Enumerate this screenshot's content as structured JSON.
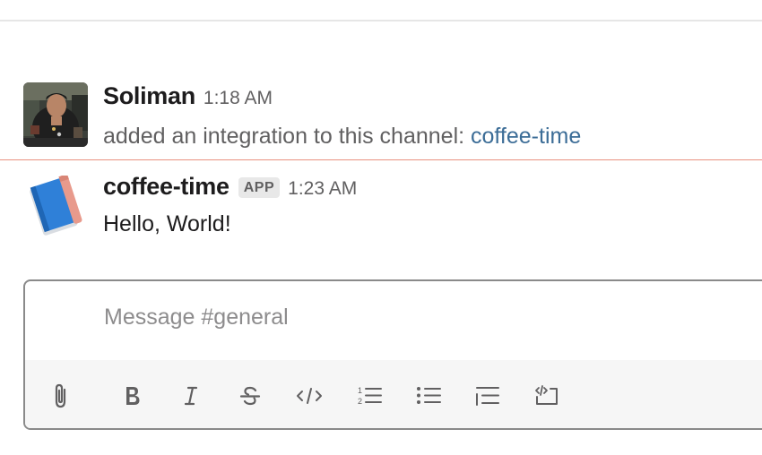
{
  "messages": [
    {
      "author": "Soliman",
      "time": "1:18 AM",
      "text_prefix": "added an integration to this channel: ",
      "integration_link": "coffee-time",
      "avatar_icon": "user-photo"
    },
    {
      "author": "coffee-time",
      "badge": "APP",
      "time": "1:23 AM",
      "text": "Hello, World!",
      "avatar_icon": "notebook-app-icon"
    }
  ],
  "composer": {
    "placeholder": "Message #general",
    "value": "",
    "toolbar": [
      {
        "name": "attach",
        "icon": "paperclip-icon"
      },
      {
        "name": "bold",
        "icon": "bold-icon"
      },
      {
        "name": "italic",
        "icon": "italic-icon"
      },
      {
        "name": "strikethrough",
        "icon": "strikethrough-icon"
      },
      {
        "name": "code",
        "icon": "code-icon"
      },
      {
        "name": "ordered-list",
        "icon": "ordered-list-icon"
      },
      {
        "name": "bulleted-list",
        "icon": "bulleted-list-icon"
      },
      {
        "name": "blockquote",
        "icon": "blockquote-icon"
      },
      {
        "name": "code-block",
        "icon": "code-block-icon"
      }
    ]
  },
  "colors": {
    "link": "#3c6d97",
    "new_message_divider": "#e8917f",
    "timestamp": "#616061",
    "placeholder": "#8d8c8d",
    "toolbar_background": "#f6f6f6",
    "app_icon_blue": "#2f80d8",
    "app_icon_pink": "#e89a8c"
  }
}
